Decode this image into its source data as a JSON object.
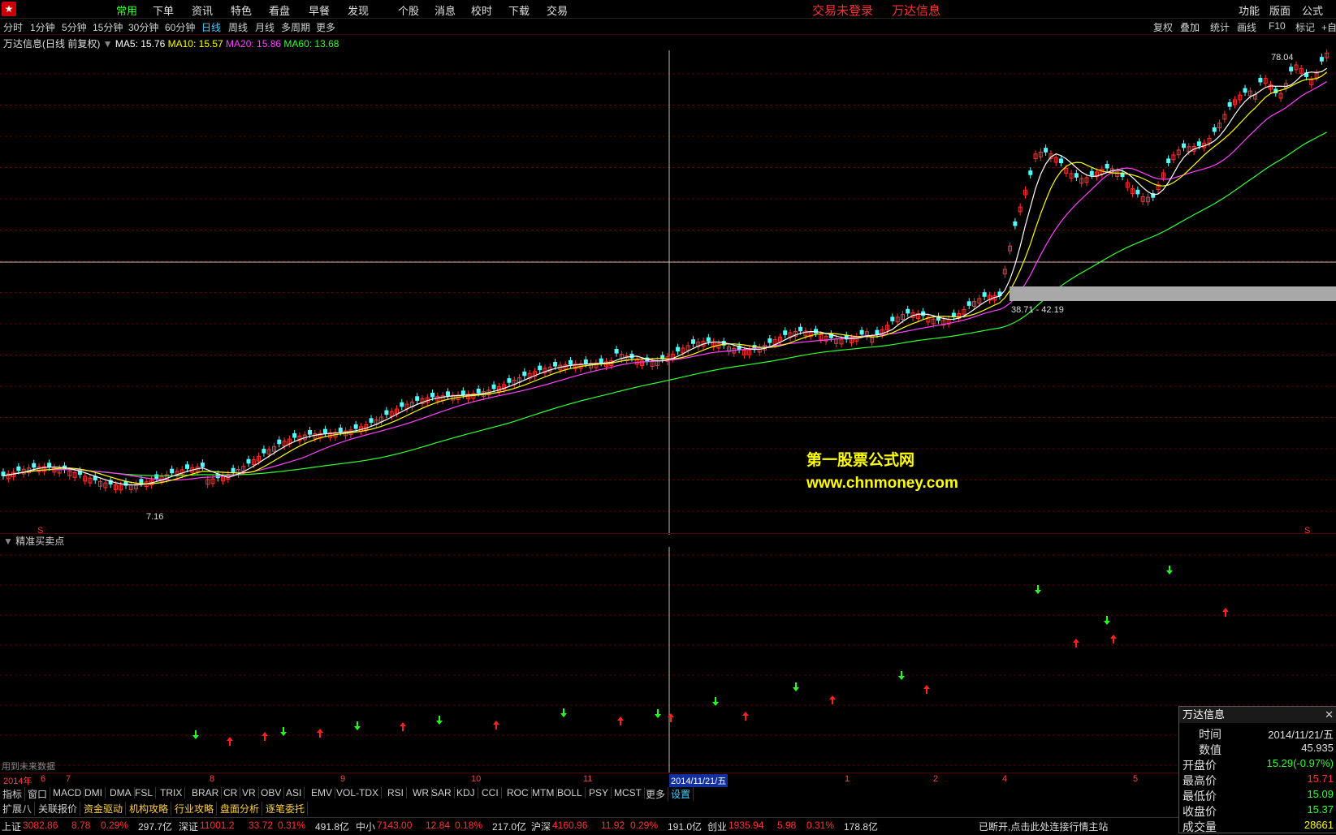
{
  "menu": {
    "items": [
      "常用",
      "下单",
      "资讯",
      "特色",
      "看盘",
      "早餐",
      "发现",
      "个股",
      "消息",
      "校时",
      "下载",
      "交易"
    ],
    "active_index": 0,
    "alert_text": "交易未登录",
    "brand_text": "万达信息",
    "right_items": [
      "功能",
      "版面",
      "公式"
    ]
  },
  "toolbar": {
    "periods": [
      "分时",
      "1分钟",
      "5分钟",
      "15分钟",
      "30分钟",
      "60分钟",
      "日线",
      "周线",
      "月线",
      "多周期",
      "更多"
    ],
    "active_period": "日线",
    "right_buttons": [
      "复权",
      "叠加",
      "统计",
      "画线",
      "F10",
      "标记",
      "+自"
    ]
  },
  "main_info": {
    "title": "万达信息(日线 前复权)",
    "ma5": "MA5: 15.76",
    "ma10": "MA10: 15.57",
    "ma20": "MA20: 15.86",
    "ma60": "MA60: 13.68"
  },
  "annotations": {
    "high_label": "78.04",
    "low_label": "7.16",
    "range_label": "38.71 - 42.19",
    "s_marker": "S"
  },
  "watermark": {
    "line1": "第一股票公式网",
    "line2": "www.chnmoney.com"
  },
  "sub_panel": {
    "title": "精准买卖点",
    "future_note": "用到未来数据"
  },
  "date_axis": {
    "year_label": "2014年",
    "labels": [
      "6",
      "7",
      "8",
      "9",
      "10",
      "11",
      "2014/11/21/五",
      "1",
      "2",
      "4",
      "5"
    ]
  },
  "indicator_tabs": [
    "指标",
    "窗口",
    "MACD",
    "DMI",
    "DMA",
    "FSL",
    "TRIX",
    "BRAR",
    "CR",
    "VR",
    "OBV",
    "ASI",
    "EMV",
    "VOL-TDX",
    "RSI",
    "WR",
    "SAR",
    "KDJ",
    "CCI",
    "ROC",
    "MTM",
    "BOLL",
    "PSY",
    "MCST",
    "更多",
    "设置"
  ],
  "function_tabs": [
    "扩展八",
    "关联报价",
    "资金驱动",
    "机构攻略",
    "行业攻略",
    "盘面分析",
    "逐笔委托"
  ],
  "status_bar": {
    "items": [
      {
        "name": "上证",
        "value": "3082.86",
        "change": "8.78",
        "pct": "0.29%",
        "amount": "297.7亿"
      },
      {
        "name": "深证",
        "value": "11001.2",
        "change": "33.72",
        "pct": "0.31%",
        "amount": "491.8亿"
      },
      {
        "name": "中小",
        "value": "7143.00",
        "change": "12.84",
        "pct": "0.18%",
        "amount": "217.0亿"
      },
      {
        "name": "沪深",
        "value": "4160.96",
        "change": "11.92",
        "pct": "0.29%",
        "amount": "191.0亿"
      },
      {
        "name": "创业",
        "value": "1935.94",
        "change": "5.98",
        "pct": "0.31%",
        "amount": "178.8亿"
      }
    ],
    "connection": "已断开,点击此处连接行情主站"
  },
  "info_box": {
    "title": "万达信息",
    "rows": [
      {
        "label": "时间",
        "value": "2014/11/21/五",
        "color": "#e0e0e0"
      },
      {
        "label": "数值",
        "value": "45.935",
        "color": "#e0e0e0"
      },
      {
        "label": "开盘价",
        "value": "15.29(-0.97%)",
        "color": "#30ff30"
      },
      {
        "label": "最高价",
        "value": "15.71",
        "color": "#ff3030"
      },
      {
        "label": "最低价",
        "value": "15.09",
        "color": "#30ff30"
      },
      {
        "label": "收盘价",
        "value": "15.37",
        "color": "#30ff30"
      },
      {
        "label": "成交量",
        "value": "28661",
        "color": "#ffff00"
      }
    ]
  },
  "colors": {
    "up": "#ff3030",
    "down": "#54ffff",
    "ma5": "#ffffff",
    "ma10": "#ffff00",
    "ma20": "#ff40ff",
    "ma60": "#30ff30"
  }
}
